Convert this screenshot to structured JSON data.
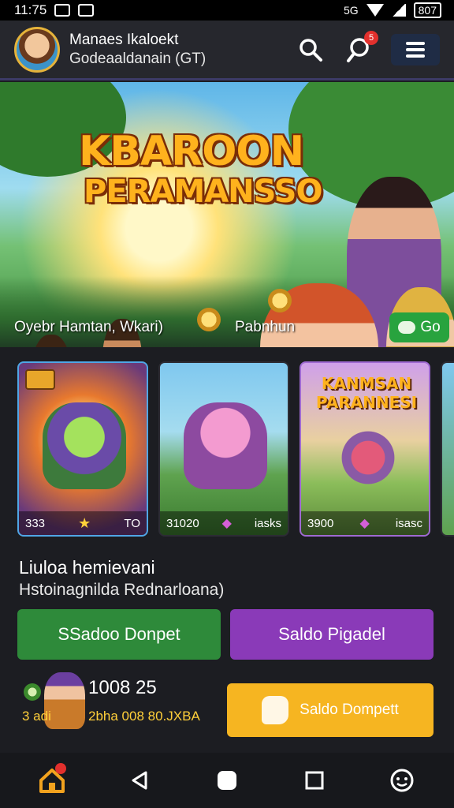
{
  "status_bar": {
    "time": "11:75",
    "network": "5G",
    "battery": "807"
  },
  "header": {
    "user_name": "Manaes Ikaloekt",
    "user_sub": "Godeaaldanain (GT)",
    "notification_count": "5"
  },
  "hero": {
    "title_line1": "KBAROON",
    "title_line2": "PERAMANSSO",
    "caption_left": "Oyebr Hamtan, Wkari)",
    "caption_right": "Pabnhun",
    "go_label": "Go"
  },
  "cards": [
    {
      "title": "",
      "left": "333",
      "right": "TO"
    },
    {
      "title": "",
      "left": "31020",
      "right": "iasks"
    },
    {
      "title": "KANMSAN PARANNESI",
      "left": "3900",
      "right": "isasc"
    }
  ],
  "info": {
    "title": "Liuloa hemievani",
    "subtitle": "Hstoinagnilda Rednarloana)"
  },
  "buttons": {
    "green": "SSadoo Donpet",
    "purple": "Saldo Pigadel",
    "yellow": "Saldo Dompett"
  },
  "balance": {
    "amount": "1008 25",
    "side_label": "3 adi",
    "detail": "2bha 008 80.JXBA"
  },
  "colors": {
    "accent_green": "#2e8a3a",
    "accent_purple": "#8a3ab8",
    "accent_yellow": "#f6b521",
    "title_gold": "#ffb21d"
  },
  "nav": [
    "home-icon",
    "back-icon",
    "home-circle-icon",
    "recents-icon",
    "profile-icon"
  ]
}
